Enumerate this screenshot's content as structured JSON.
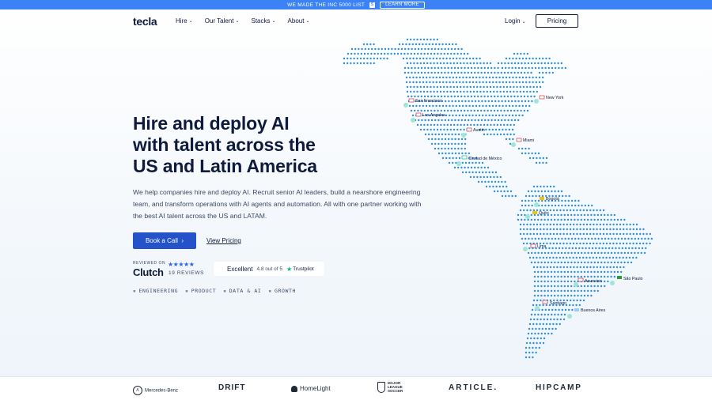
{
  "announcement": {
    "text": "WE MADE THE INC 5000 LIST",
    "cta": "LEARN MORE"
  },
  "nav": {
    "logo": "tecla",
    "items": [
      {
        "label": "Hire"
      },
      {
        "label": "Our Talent"
      },
      {
        "label": "Stacks"
      },
      {
        "label": "About"
      }
    ],
    "login": "Login",
    "pricing": "Pricing"
  },
  "hero": {
    "title_lines": [
      "Hire and deploy AI",
      "with talent across the",
      "US and Latin America"
    ],
    "description": "We help companies hire and deploy AI. Recruit senior AI leaders, build a nearshore engineering team, and transform operations with AI agents and automation. All with one partner working with the best AI talent across the US and LATAM.",
    "primary_cta": "Book a Call",
    "primary_cta_icon": "chevron-right-icon",
    "secondary_cta": "View Pricing"
  },
  "social_proof": {
    "clutch": {
      "reviewed_on": "REVIEWED ON",
      "brand": "Clutch",
      "stars": "★★★★★",
      "reviews": "19 REVIEWS"
    },
    "trustpilot": {
      "rating_word": "Excellent",
      "score": "4.8 out of 5",
      "star": "★",
      "brand": "Trustpilot"
    }
  },
  "tags": [
    "ENGINEERING",
    "PRODUCT",
    "DATA & AI",
    "GROWTH"
  ],
  "map": {
    "dot_color": "#2b8fe0",
    "marker_color": "#9fe6d6",
    "cities": [
      {
        "name": "San Francisco",
        "flag": "us"
      },
      {
        "name": "Los Angeles",
        "flag": "us"
      },
      {
        "name": "New York",
        "flag": "us"
      },
      {
        "name": "Austin",
        "flag": "us"
      },
      {
        "name": "Miami",
        "flag": "us"
      },
      {
        "name": "Ciudad de México",
        "flag": "mx"
      },
      {
        "name": "Bogotá",
        "flag": "co"
      },
      {
        "name": "Quito",
        "flag": "ec"
      },
      {
        "name": "Lima",
        "flag": "pe"
      },
      {
        "name": "Asuncion",
        "flag": "py"
      },
      {
        "name": "São Paulo",
        "flag": "br"
      },
      {
        "name": "Santiago",
        "flag": "cl"
      },
      {
        "name": "Buenos Aires",
        "flag": "ar"
      }
    ]
  },
  "clients": {
    "mercedes": "Mercedes-Benz",
    "drift": "DRIFT",
    "homelight": "HomeLight",
    "mls": "MAJOR LEAGUE SOCCER",
    "article": "ARTICLE.",
    "hipcamp": "HIPCAMP"
  },
  "colors": {
    "primary": "#2453c9",
    "announcement_bar": "#3b82f6",
    "text": "#0f1b3d"
  }
}
